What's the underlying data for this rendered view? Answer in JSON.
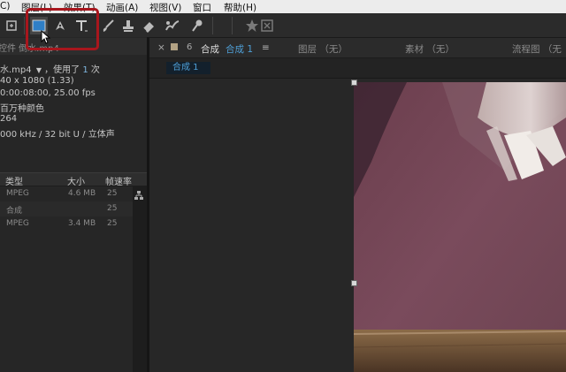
{
  "menu": {
    "items": [
      "C)",
      "图层(L)",
      "效果(T)",
      "动画(A)",
      "视图(V)",
      "窗口",
      "帮助(H)"
    ]
  },
  "toolbar": {
    "tools": [
      "pan-tool",
      "rectangle-tool",
      "pen-tool",
      "type-tool",
      "brush-tool",
      "clone-stamp-tool",
      "eraser-tool",
      "roto-brush-tool",
      "puppet-pin-tool"
    ],
    "highlight_color": "#a8161d",
    "active_color": "#2f7fc7"
  },
  "project": {
    "tab_label": "控件 倒水.mp4",
    "file": {
      "name": "水.mp4",
      "dropdown": "▼",
      "usage_label": "，使用了",
      "usage_count": "1",
      "usage_unit": "次",
      "resolution": "40 x 1080 (1.33)",
      "duration": "0:00:08:00, 25.00 fps",
      "colors": "百万种颜色",
      "codec": "264",
      "audio": "000 kHz / 32 bit U / 立体声"
    },
    "columns": {
      "type": "类型",
      "size": "大小",
      "fps": "帧速率"
    },
    "rows": [
      {
        "type": "MPEG",
        "size": "4.6 MB",
        "fps": "25"
      },
      {
        "type": "合成",
        "size": "",
        "fps": "25"
      },
      {
        "type": "MPEG",
        "size": "3.4 MB",
        "fps": "25"
      }
    ]
  },
  "comp_panel": {
    "close": "×",
    "lock": "6",
    "comp_tab": "合成",
    "comp_name": "合成 1",
    "menu_icon": "≡",
    "layer_tab": "图层 （无）",
    "footage_tab": "素材 （无）",
    "flow_tab": "流程图 （无",
    "sub_tab": "合成 1",
    "accent": "#4f9fd6"
  }
}
